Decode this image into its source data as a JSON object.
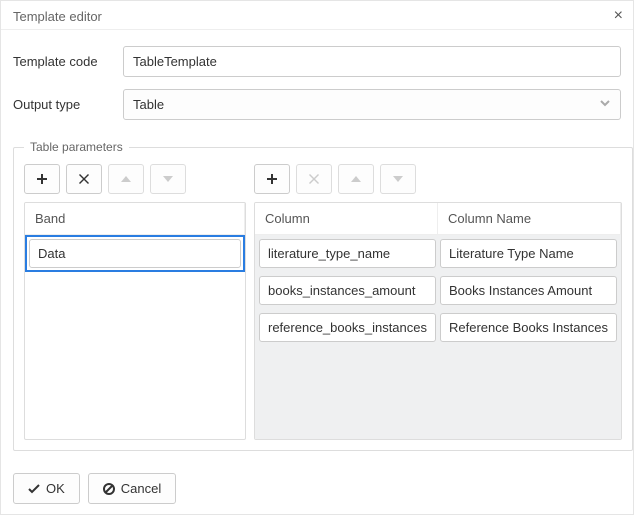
{
  "dialog": {
    "title": "Template editor"
  },
  "form": {
    "code_label": "Template code",
    "code_value": "TableTemplate",
    "output_label": "Output type",
    "output_value": "Table"
  },
  "params": {
    "legend": "Table parameters",
    "band_header": "Band",
    "band_value": "Data",
    "col_header_key": "Column",
    "col_header_name": "Column Name",
    "columns": [
      {
        "key": "literature_type_name",
        "name": "Literature Type Name"
      },
      {
        "key": "books_instances_amount",
        "name": "Books Instances Amount"
      },
      {
        "key": "reference_books_instances",
        "name": "Reference Books Instances"
      }
    ]
  },
  "actions": {
    "ok": "OK",
    "cancel": "Cancel"
  }
}
